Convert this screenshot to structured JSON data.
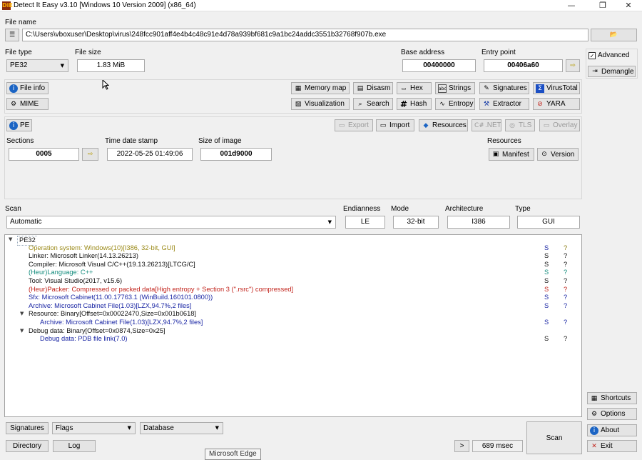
{
  "window": {
    "title": "Detect It Easy v3.10 [Windows 10 Version 2009] (x86_64)",
    "icon_text": "DiE",
    "controls": {
      "minimize": "—",
      "restore": "❐",
      "close": "✕"
    }
  },
  "file": {
    "label": "File name",
    "path": "C:\\Users\\vboxuser\\Desktop\\virus\\248fcc901aff4e4b4c48c91e4d78a939bf681c9a1bc24addc3551b32768f907b.exe"
  },
  "info": {
    "file_type_label": "File type",
    "file_type": "PE32",
    "file_size_label": "File size",
    "file_size": "1.83 MiB",
    "base_address_label": "Base address",
    "base_address": "00400000",
    "entry_point_label": "Entry point",
    "entry_point": "00406a60"
  },
  "right_panel": {
    "advanced": "Advanced",
    "advanced_checked": true,
    "demangle": "Demangle"
  },
  "tools": {
    "file_info": "File info",
    "mime": "MIME",
    "memory_map": "Memory map",
    "visualization": "Visualization",
    "disasm": "Disasm",
    "search": "Search",
    "hex": "Hex",
    "hash": "Hash",
    "strings": "Strings",
    "entropy": "Entropy",
    "signatures": "Signatures",
    "extractor": "Extractor",
    "virustotal": "VirusTotal",
    "yara": "YARA"
  },
  "pe": {
    "pe_button": "PE",
    "export": "Export",
    "import": "Import",
    "resources": "Resources",
    "net": ".NET",
    "tls": "TLS",
    "overlay": "Overlay",
    "sections_label": "Sections",
    "sections": "0005",
    "timestamp_label": "Time date stamp",
    "timestamp": "2022-05-25 01:49:06",
    "size_of_image_label": "Size of image",
    "size_of_image": "001d9000",
    "resources_label": "Resources",
    "manifest": "Manifest",
    "version": "Version"
  },
  "scan": {
    "label": "Scan",
    "mode_value": "Automatic",
    "endianness_label": "Endianness",
    "endianness": "LE",
    "mode_label": "Mode",
    "mode": "32-bit",
    "architecture_label": "Architecture",
    "architecture": "I386",
    "type_label": "Type",
    "type": "GUI"
  },
  "results": [
    {
      "text": "PE32",
      "level": 0,
      "expanded": true,
      "color": "#111111",
      "s": "",
      "q": ""
    },
    {
      "text": "Operation system: Windows(10)[I386, 32-bit, GUI]",
      "level": 1,
      "color": "#9b8a18",
      "s": "S",
      "q": "?",
      "scol": "#1a26a4",
      "qcol": "#8a7a10"
    },
    {
      "text": "Linker: Microsoft Linker(14.13.26213)",
      "level": 1,
      "color": "#111111",
      "s": "S",
      "q": "?",
      "scol": "#111111",
      "qcol": "#111111"
    },
    {
      "text": "Compiler: Microsoft Visual C/C++(19.13.26213)[LTCG/C]",
      "level": 1,
      "color": "#111111",
      "s": "S",
      "q": "?",
      "scol": "#111111",
      "qcol": "#111111"
    },
    {
      "text": "(Heur)Language: C++",
      "level": 1,
      "color": "#148c7d",
      "s": "S",
      "q": "?",
      "scol": "#148c7d",
      "qcol": "#148c7d"
    },
    {
      "text": "Tool: Visual Studio(2017, v15.6)",
      "level": 1,
      "color": "#111111",
      "s": "S",
      "q": "?",
      "scol": "#111111",
      "qcol": "#111111"
    },
    {
      "text": "(Heur)Packer: Compressed or packed data[High entropy + Section 3 (\".rsrc\") compressed]",
      "level": 1,
      "color": "#c2241c",
      "s": "S",
      "q": "?",
      "scol": "#c2241c",
      "qcol": "#c2241c"
    },
    {
      "text": "Sfx: Microsoft Cabinet(11.00.17763.1 (WinBuild.160101.0800))",
      "level": 1,
      "color": "#1a26a4",
      "s": "S",
      "q": "?",
      "scol": "#1a26a4",
      "qcol": "#1a26a4"
    },
    {
      "text": "Archive: Microsoft Cabinet File(1.03)[LZX,94.7%,2 files]",
      "level": 1,
      "color": "#1a26a4",
      "s": "S",
      "q": "?",
      "scol": "#1a26a4",
      "qcol": "#1a26a4"
    },
    {
      "text": "Resource: Binary[Offset=0x00022470,Size=0x001b0618]",
      "level": 1,
      "expanded": true,
      "color": "#111111",
      "s": "",
      "q": ""
    },
    {
      "text": "Archive: Microsoft Cabinet File(1.03)[LZX,94.7%,2 files]",
      "level": 2,
      "color": "#1a26a4",
      "s": "S",
      "q": "?",
      "scol": "#1a26a4",
      "qcol": "#1a26a4"
    },
    {
      "text": "Debug data: Binary[Offset=0x0874,Size=0x25]",
      "level": 1,
      "expanded": true,
      "color": "#111111",
      "s": "",
      "q": ""
    },
    {
      "text": "Debug data: PDB file link(7.0)",
      "level": 2,
      "color": "#1a26a4",
      "s": "S",
      "q": "?",
      "scol": "#111111",
      "qcol": "#111111"
    }
  ],
  "footer": {
    "signatures": "Signatures",
    "flags": "Flags",
    "database": "Database",
    "directory": "Directory",
    "log": "Log",
    "more": ">",
    "elapsed": "689 msec",
    "scan": "Scan",
    "shortcuts": "Shortcuts",
    "options": "Options",
    "about": "About",
    "exit": "Exit",
    "tooltip": "Microsoft Edge"
  },
  "icons": {
    "list": "☰",
    "folder": "📂",
    "arrow": "⇨",
    "info": "i",
    "gear": "⚙",
    "grid": "▦",
    "image": "▨",
    "disasm": "▤",
    "search": "⌕",
    "hex": "▭",
    "hash": "#",
    "strings": "abc",
    "entropy": "∿",
    "signatures": "✎",
    "extractor": "⚒",
    "virustotal": "Σ",
    "yara": "⊘",
    "manifest": "▣",
    "version": "⊙",
    "about": "i",
    "exit": "✕"
  }
}
